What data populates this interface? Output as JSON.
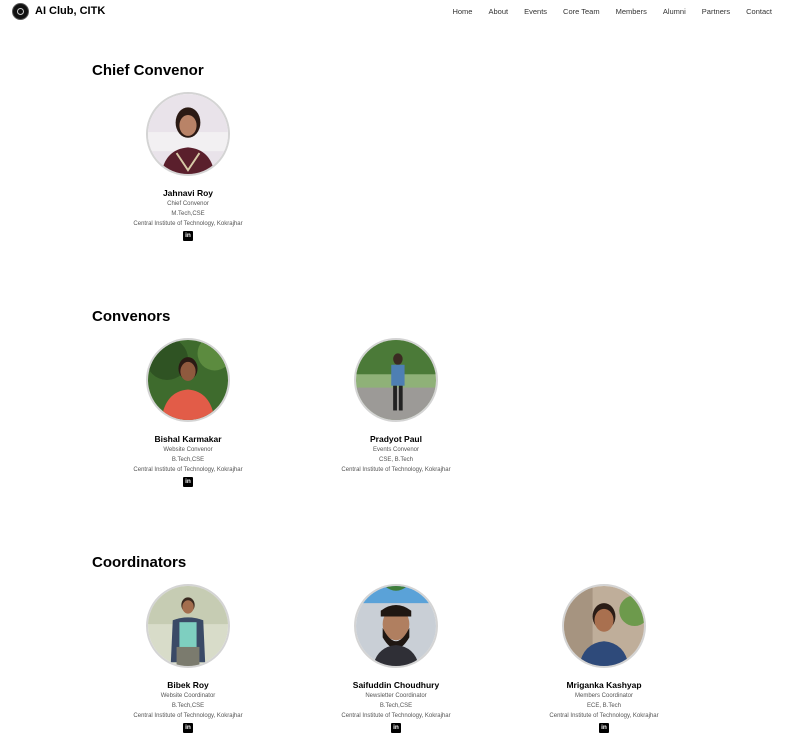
{
  "navbar": {
    "brand": "AI Club, CITK",
    "links": [
      "Home",
      "About",
      "Events",
      "Core Team",
      "Members",
      "Alumni",
      "Partners",
      "Contact"
    ]
  },
  "sections": {
    "chief": {
      "title": "Chief Convenor",
      "members": [
        {
          "name": "Jahnavi Roy",
          "role": "Chief Convenor",
          "degree": "M.Tech,CSE",
          "institute": "Central Institute of Technology, Kokrajhar",
          "linkedin": "in"
        }
      ]
    },
    "convenors": {
      "title": "Convenors",
      "members": [
        {
          "name": "Bishal Karmakar",
          "role": "Website Convenor",
          "degree": "B.Tech,CSE",
          "institute": "Central Institute of Technology, Kokrajhar",
          "linkedin": "in"
        },
        {
          "name": "Pradyot Paul",
          "role": "Events Convenor",
          "degree": "CSE, B.Tech",
          "institute": "Central Institute of Technology, Kokrajhar"
        }
      ]
    },
    "coordinators": {
      "title": "Coordinators",
      "members": [
        {
          "name": "Bibek Roy",
          "role": "Website Coordinator",
          "degree": "B.Tech,CSE",
          "institute": "Central Institute of Technology, Kokrajhar",
          "linkedin": "in"
        },
        {
          "name": "Saifuddin Choudhury",
          "role": "Newsletter Coordinator",
          "degree": "B.Tech,CSE",
          "institute": "Central Institute of Technology, Kokrajhar",
          "linkedin": "in"
        },
        {
          "name": "Mriganka Kashyap",
          "role": "Members Coordinator",
          "degree": "ECE, B.Tech",
          "institute": "Central Institute of Technology, Kokrajhar",
          "linkedin": "in"
        }
      ]
    }
  },
  "colors": {
    "text": "#000000",
    "muted": "#555555",
    "avatar_border": "#d4d4d4"
  }
}
